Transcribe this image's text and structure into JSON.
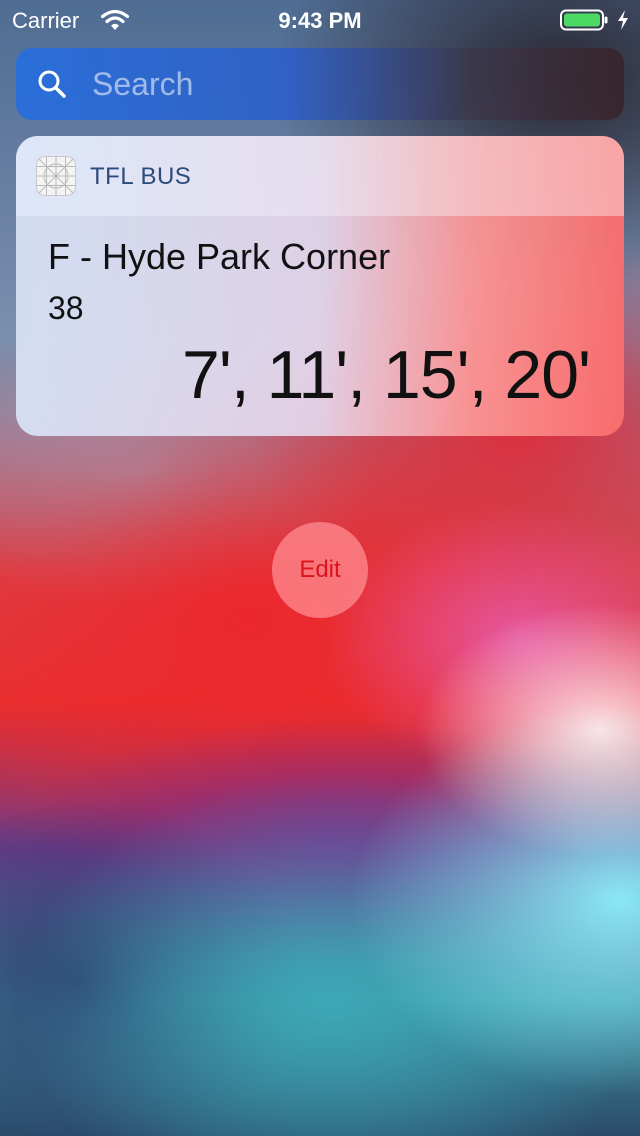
{
  "status_bar": {
    "carrier": "Carrier",
    "time": "9:43 PM",
    "battery_color": "#4cd964"
  },
  "search": {
    "placeholder": "Search"
  },
  "widget": {
    "app_name": "TFL BUS",
    "destination": "F - Hyde Park Corner",
    "route_number": "38",
    "arrivals": "7', 11', 15', 20'"
  },
  "edit_button": {
    "label": "Edit",
    "color": "#d8141c"
  }
}
